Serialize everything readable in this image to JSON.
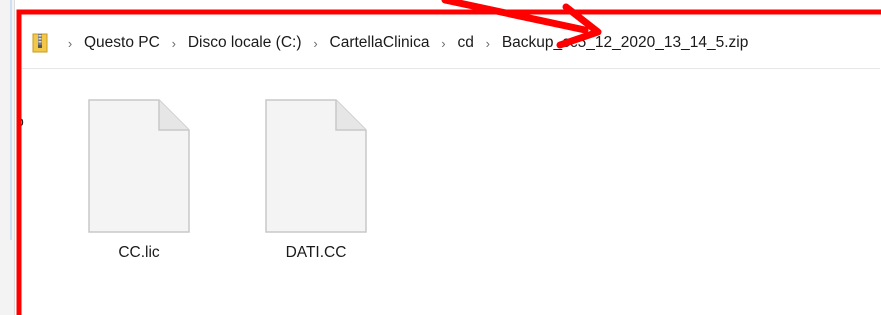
{
  "breadcrumb": {
    "items": [
      {
        "label": "Questo PC"
      },
      {
        "label": "Disco locale (C:)"
      },
      {
        "label": "CartellaClinica"
      },
      {
        "label": "cd"
      },
      {
        "label": "Backup_cc5_12_2020_13_14_5.zip"
      }
    ],
    "separator": "›"
  },
  "files": [
    {
      "name": "CC.lic",
      "icon": "document-icon"
    },
    {
      "name": "DATI.CC",
      "icon": "document-icon"
    }
  ],
  "icons": {
    "folder": "zip-folder-icon"
  },
  "colors": {
    "annotation": "#ff0000",
    "file_icon_fill": "#f4f4f4",
    "file_icon_border": "#c8c8c8"
  }
}
